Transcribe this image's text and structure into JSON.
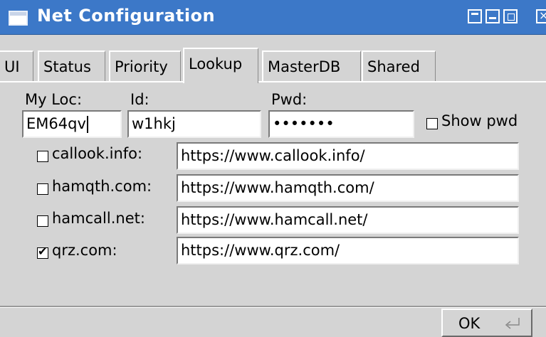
{
  "window": {
    "title": "Net Configuration"
  },
  "tabs": [
    "UI",
    "Status",
    "Priority",
    "Lookup",
    "MasterDB",
    "Shared"
  ],
  "active_tab": "Lookup",
  "fields": {
    "myloc_label": "My Loc:",
    "myloc_value": "EM64qv",
    "id_label": "Id:",
    "id_value": "w1hkj",
    "pwd_label": "Pwd:",
    "pwd_value": "•••••••",
    "show_pwd_label": "Show pwd",
    "show_pwd_checked": false
  },
  "lookups": [
    {
      "label": "callook.info:",
      "url": "https://www.callook.info/",
      "checked": false
    },
    {
      "label": "hamqth.com:",
      "url": "https://www.hamqth.com/",
      "checked": false
    },
    {
      "label": "hamcall.net:",
      "url": "https://www.hamcall.net/",
      "checked": false
    },
    {
      "label": "qrz.com:",
      "url": "https://www.qrz.com/",
      "checked": true
    }
  ],
  "ok_label": "OK",
  "icons": {
    "app": "window-icon",
    "ok": "return-icon"
  },
  "colors": {
    "titlebar": "#3c78c8",
    "background": "#d4d4d4"
  }
}
